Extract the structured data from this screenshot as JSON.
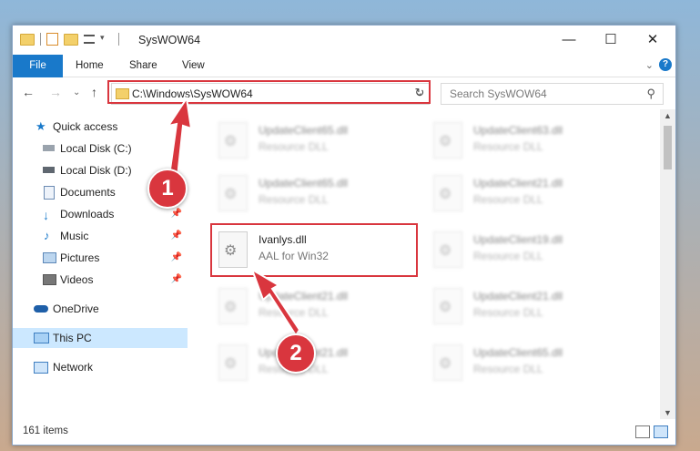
{
  "window": {
    "title": "SysWOW64",
    "controls": {
      "minimize": "—",
      "maximize": "☐",
      "close": "✕"
    }
  },
  "ribbon": {
    "tabs": [
      "File",
      "Home",
      "Share",
      "View"
    ],
    "expand_chevron": "⌄",
    "help": "?"
  },
  "nav": {
    "back": "←",
    "forward": "→",
    "recent": "⌄",
    "up": "↑"
  },
  "address": {
    "path": "C:\\Windows\\SysWOW64",
    "chevron": "⌄",
    "refresh": "↻"
  },
  "search": {
    "placeholder": "Search SysWOW64",
    "icon": "⚲"
  },
  "sidebar": {
    "items": [
      {
        "label": "Quick access",
        "icon": "star-icon"
      },
      {
        "label": "Local Disk (C:)",
        "icon": "drive-icon"
      },
      {
        "label": "Local Disk (D:)",
        "icon": "drive-icon"
      },
      {
        "label": "Documents",
        "icon": "documents-icon"
      },
      {
        "label": "Downloads",
        "icon": "download-icon"
      },
      {
        "label": "Music",
        "icon": "music-icon"
      },
      {
        "label": "Pictures",
        "icon": "pictures-icon"
      },
      {
        "label": "Videos",
        "icon": "videos-icon"
      },
      {
        "label": "OneDrive",
        "icon": "cloud-icon"
      },
      {
        "label": "This PC",
        "icon": "computer-icon"
      },
      {
        "label": "Network",
        "icon": "network-icon"
      }
    ]
  },
  "files": [
    {
      "name": "UpdateClient65.dll",
      "desc": "Resource DLL"
    },
    {
      "name": "UpdateClient63.dll",
      "desc": "Resource DLL"
    },
    {
      "name": "UpdateClient65.dll",
      "desc": "Resource DLL"
    },
    {
      "name": "UpdateClient21.dll",
      "desc": "Resource DLL"
    },
    {
      "name": "Ivanlys.dll",
      "desc": "AAL for Win32"
    },
    {
      "name": "UpdateClient19.dll",
      "desc": "Resource DLL"
    },
    {
      "name": "UpdateClient21.dll",
      "desc": "Resource DLL"
    },
    {
      "name": "UpdateClient21.dll",
      "desc": "Resource DLL"
    },
    {
      "name": "UpdateClient21.dll",
      "desc": "Resource DLL"
    },
    {
      "name": "UpdateClient65.dll",
      "desc": "Resource DLL"
    }
  ],
  "status": {
    "items": "161 items"
  },
  "callouts": {
    "one": "1",
    "two": "2"
  },
  "colors": {
    "accent": "#1979ca",
    "highlight": "#d9363e",
    "selected": "#cce8ff"
  }
}
